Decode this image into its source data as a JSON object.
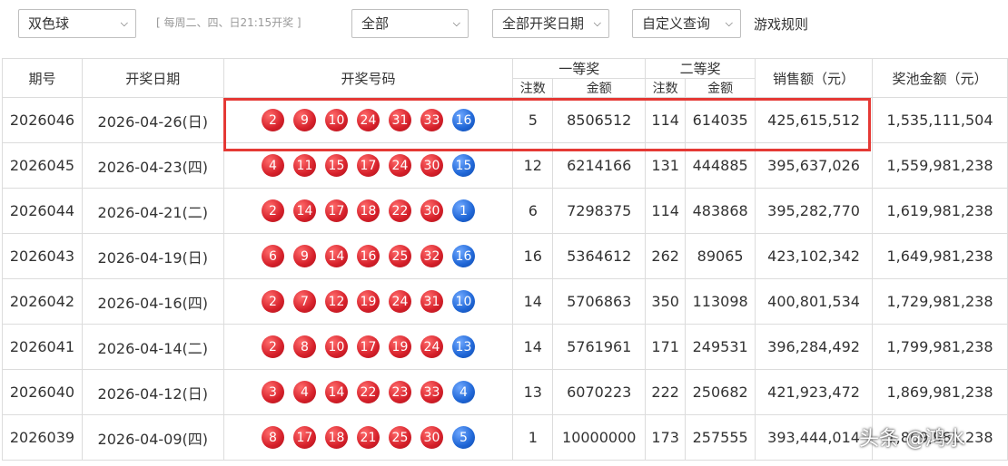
{
  "toolbar": {
    "game_select": "双色球",
    "schedule_hint": "[ 每周二、四、日21:15开奖 ]",
    "range_select": "全部",
    "date_select": "全部开奖日期",
    "custom_query": "自定义查询",
    "rules_link": "游戏规则"
  },
  "table": {
    "headers": {
      "issue": "期号",
      "date": "开奖日期",
      "numbers": "开奖号码",
      "first_prize": "一等奖",
      "second_prize": "二等奖",
      "count": "注数",
      "amount": "金额",
      "sales": "销售额（元）",
      "pool": "奖池金额（元）"
    },
    "rows": [
      {
        "issue": "2026046",
        "date": "2026-04-26(日)",
        "red": [
          "2",
          "9",
          "10",
          "24",
          "31",
          "33"
        ],
        "blue": "16",
        "p1_count": "5",
        "p1_amount": "8506512",
        "p2_count": "114",
        "p2_amount": "614035",
        "sales": "425,615,512",
        "pool": "1,535,111,504"
      },
      {
        "issue": "2026045",
        "date": "2026-04-23(四)",
        "red": [
          "4",
          "11",
          "15",
          "17",
          "24",
          "30"
        ],
        "blue": "15",
        "p1_count": "12",
        "p1_amount": "6214166",
        "p2_count": "131",
        "p2_amount": "444885",
        "sales": "395,637,026",
        "pool": "1,559,981,238"
      },
      {
        "issue": "2026044",
        "date": "2026-04-21(二)",
        "red": [
          "2",
          "14",
          "17",
          "18",
          "22",
          "30"
        ],
        "blue": "1",
        "p1_count": "6",
        "p1_amount": "7298375",
        "p2_count": "114",
        "p2_amount": "483868",
        "sales": "395,282,770",
        "pool": "1,619,981,238"
      },
      {
        "issue": "2026043",
        "date": "2026-04-19(日)",
        "red": [
          "6",
          "9",
          "14",
          "16",
          "25",
          "32"
        ],
        "blue": "16",
        "p1_count": "16",
        "p1_amount": "5364612",
        "p2_count": "262",
        "p2_amount": "89065",
        "sales": "423,102,342",
        "pool": "1,649,981,238"
      },
      {
        "issue": "2026042",
        "date": "2026-04-16(四)",
        "red": [
          "2",
          "7",
          "12",
          "19",
          "24",
          "31"
        ],
        "blue": "10",
        "p1_count": "14",
        "p1_amount": "5706863",
        "p2_count": "350",
        "p2_amount": "113098",
        "sales": "400,801,534",
        "pool": "1,729,981,238"
      },
      {
        "issue": "2026041",
        "date": "2026-04-14(二)",
        "red": [
          "2",
          "8",
          "10",
          "17",
          "19",
          "24"
        ],
        "blue": "13",
        "p1_count": "14",
        "p1_amount": "5761961",
        "p2_count": "171",
        "p2_amount": "249531",
        "sales": "396,284,492",
        "pool": "1,799,981,238"
      },
      {
        "issue": "2026040",
        "date": "2026-04-12(日)",
        "red": [
          "3",
          "4",
          "14",
          "22",
          "23",
          "33"
        ],
        "blue": "4",
        "p1_count": "13",
        "p1_amount": "6070223",
        "p2_count": "222",
        "p2_amount": "250682",
        "sales": "421,923,472",
        "pool": "1,869,981,238"
      },
      {
        "issue": "2026039",
        "date": "2026-04-09(四)",
        "red": [
          "8",
          "17",
          "18",
          "21",
          "25",
          "30"
        ],
        "blue": "5",
        "p1_count": "1",
        "p1_amount": "10000000",
        "p2_count": "173",
        "p2_amount": "257555",
        "sales": "393,444,014",
        "pool": "1,869,981,238"
      }
    ]
  },
  "watermark": "头条 @鸿水",
  "icons": {
    "dropdown": "chevron-down-icon"
  },
  "colors": {
    "red_ball": "#d6202a",
    "blue_ball": "#1f66d6",
    "highlight": "#e53935"
  }
}
